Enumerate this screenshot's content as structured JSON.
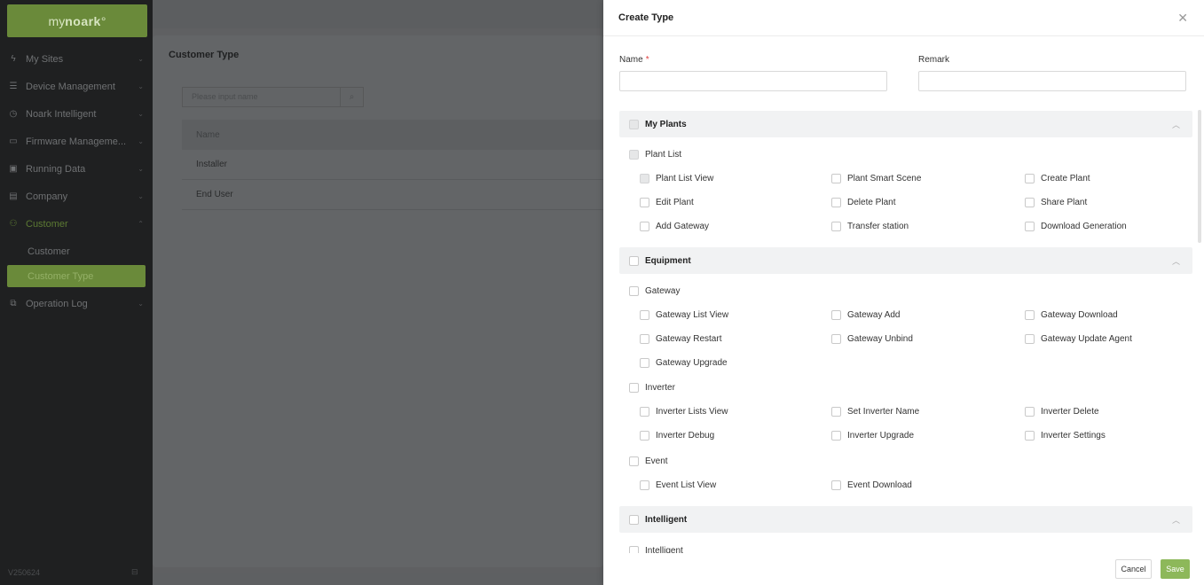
{
  "app": {
    "logo_prefix": "my",
    "logo_brand": "Noark",
    "logo_mark": "°",
    "version": "V250624"
  },
  "sidebar": {
    "items": [
      {
        "label": "My Sites",
        "icon": "lightning-icon"
      },
      {
        "label": "Device Management",
        "icon": "server-icon"
      },
      {
        "label": "Noark Intelligent",
        "icon": "clock-icon"
      },
      {
        "label": "Firmware Manageme...",
        "icon": "monitor-icon"
      },
      {
        "label": "Running Data",
        "icon": "chart-icon"
      },
      {
        "label": "Company",
        "icon": "building-icon"
      },
      {
        "label": "Customer",
        "icon": "users-icon"
      },
      {
        "label": "Operation Log",
        "icon": "log-icon"
      }
    ],
    "sub_items": [
      "Customer",
      "Customer Type"
    ]
  },
  "main": {
    "title": "Customer Type",
    "search_placeholder": "Please input name",
    "table_header": "Name",
    "rows": [
      "Installer",
      "End User"
    ]
  },
  "drawer": {
    "title": "Create Type",
    "name_label": "Name",
    "name_required": "*",
    "remark_label": "Remark",
    "name_value": "",
    "remark_value": "",
    "sections": [
      {
        "label": "My Plants",
        "groups": [
          {
            "label": "Plant List",
            "items": [
              "Plant List View",
              "Plant Smart Scene",
              "Create Plant",
              "Edit Plant",
              "Delete Plant",
              "Share Plant",
              "Add Gateway",
              "Transfer station",
              "Download Generation"
            ]
          }
        ]
      },
      {
        "label": "Equipment",
        "groups": [
          {
            "label": "Gateway",
            "items": [
              "Gateway List View",
              "Gateway Add",
              "Gateway Download",
              "Gateway Restart",
              "Gateway Unbind",
              "Gateway Update Agent",
              "Gateway Upgrade"
            ]
          },
          {
            "label": "Inverter",
            "items": [
              "Inverter Lists View",
              "Set Inverter Name",
              "Inverter Delete",
              "Inverter Debug",
              "Inverter Upgrade",
              "Inverter Settings"
            ]
          },
          {
            "label": "Event",
            "items": [
              "Event List View",
              "Event Download"
            ]
          }
        ]
      },
      {
        "label": "Intelligent",
        "groups": [
          {
            "label": "Intelligent",
            "items": []
          }
        ]
      }
    ],
    "cancel_label": "Cancel",
    "save_label": "Save"
  },
  "colors": {
    "brand": "#6a8a3a",
    "save": "#8db85a",
    "required": "#e04040"
  }
}
